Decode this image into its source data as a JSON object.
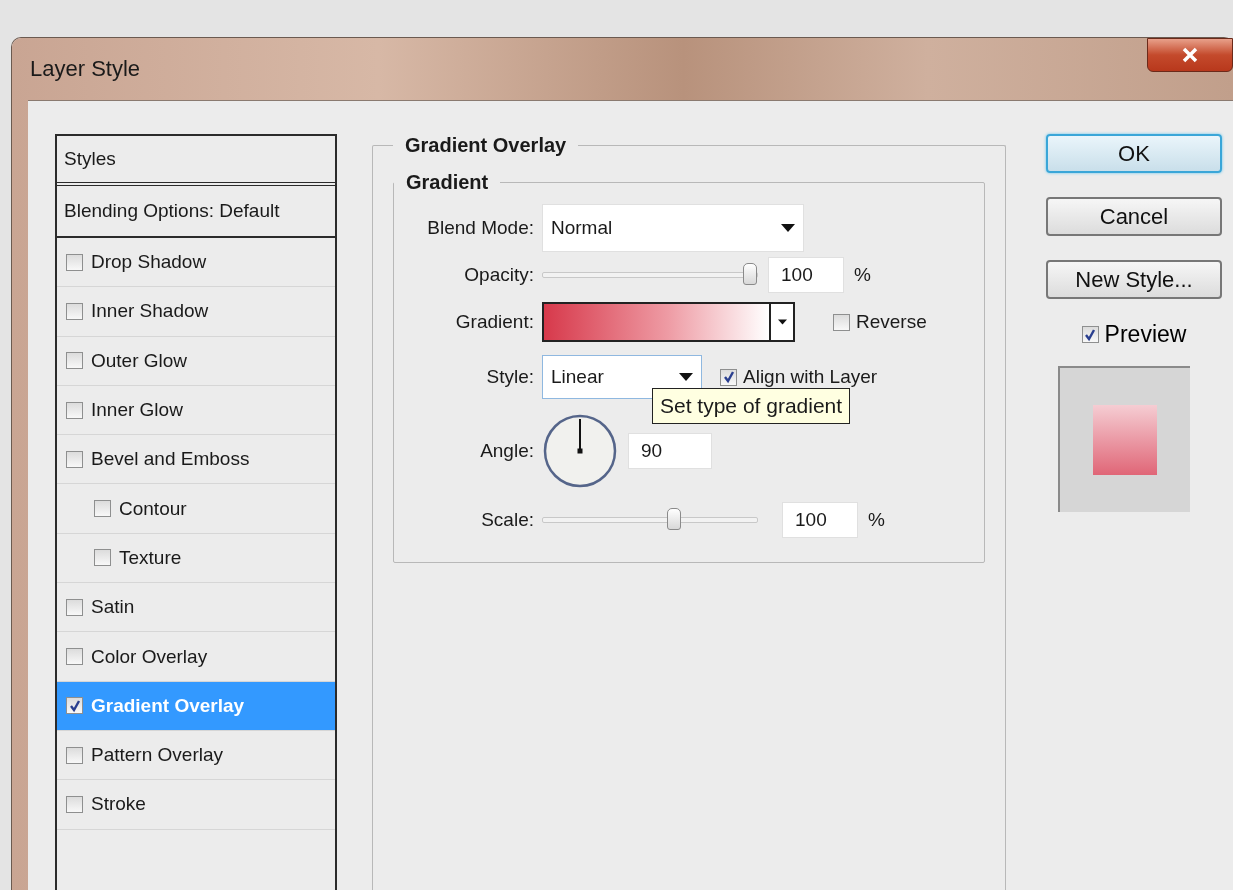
{
  "window": {
    "title": "Layer Style"
  },
  "styles_panel": {
    "header": "Styles",
    "blending_options": "Blending Options: Default",
    "items": [
      {
        "label": "Drop Shadow",
        "checked": false,
        "selected": false
      },
      {
        "label": "Inner Shadow",
        "checked": false,
        "selected": false
      },
      {
        "label": "Outer Glow",
        "checked": false,
        "selected": false
      },
      {
        "label": "Inner Glow",
        "checked": false,
        "selected": false
      },
      {
        "label": "Bevel and Emboss",
        "checked": false,
        "selected": false,
        "children": [
          {
            "label": "Contour",
            "checked": false,
            "selected": false
          },
          {
            "label": "Texture",
            "checked": false,
            "selected": false
          }
        ]
      },
      {
        "label": "Satin",
        "checked": false,
        "selected": false
      },
      {
        "label": "Color Overlay",
        "checked": false,
        "selected": false
      },
      {
        "label": "Gradient Overlay",
        "checked": true,
        "selected": true
      },
      {
        "label": "Pattern Overlay",
        "checked": false,
        "selected": false
      },
      {
        "label": "Stroke",
        "checked": false,
        "selected": false
      }
    ]
  },
  "gradient_overlay": {
    "title": "Gradient Overlay",
    "group": "Gradient",
    "blend_mode": {
      "label": "Blend Mode:",
      "value": "Normal"
    },
    "opacity": {
      "label": "Opacity:",
      "level": 1,
      "value": "100",
      "unit": "%"
    },
    "gradient": {
      "label": "Gradient:"
    },
    "reverse": {
      "label": "Reverse",
      "checked": false
    },
    "style": {
      "label": "Style:",
      "value": "Linear"
    },
    "align_with_layer": {
      "label": "Align with Layer",
      "checked": true
    },
    "tooltip": "Set type of gradient",
    "angle": {
      "label": "Angle:",
      "value": "90"
    },
    "scale": {
      "label": "Scale:",
      "level": 0.62,
      "value": "100",
      "unit": "%"
    }
  },
  "buttons": [
    {
      "label": "OK",
      "default": true
    },
    {
      "label": "Cancel",
      "default": false
    },
    {
      "label": "New Style...",
      "default": false
    }
  ],
  "preview": {
    "label": "Preview",
    "checked": true
  }
}
